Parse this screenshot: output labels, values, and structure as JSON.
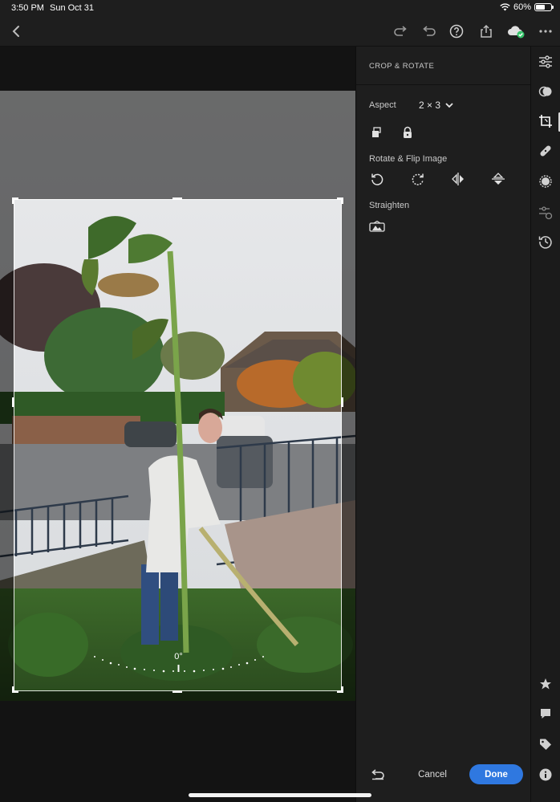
{
  "status_bar": {
    "time": "3:50 PM",
    "date": "Sun Oct 31",
    "battery": "60%"
  },
  "toolbar": {
    "back_icon": "chevron-left-icon",
    "redo_icon": "redo-icon",
    "undo_icon": "undo-icon",
    "help_icon": "help-icon",
    "share_icon": "share-icon",
    "cloud_icon": "cloud-synced-icon",
    "more_icon": "more-icon"
  },
  "canvas": {
    "angle": "0°"
  },
  "panel": {
    "title": "CROP & ROTATE",
    "aspect_label": "Aspect",
    "aspect_value": "2 × 3",
    "rotate_label": "Rotate & Flip Image",
    "straighten_label": "Straighten"
  },
  "footer": {
    "cancel": "Cancel",
    "done": "Done"
  },
  "colors": {
    "accent": "#2f78e0",
    "panel_bg": "#1e1e1e",
    "cloud_ok": "#36c36b"
  }
}
